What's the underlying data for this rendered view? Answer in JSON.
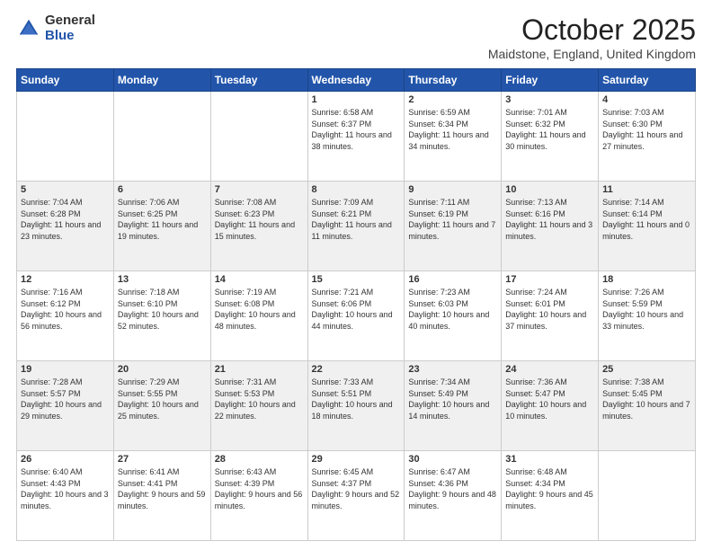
{
  "header": {
    "logo_general": "General",
    "logo_blue": "Blue",
    "title": "October 2025",
    "subtitle": "Maidstone, England, United Kingdom"
  },
  "weekdays": [
    "Sunday",
    "Monday",
    "Tuesday",
    "Wednesday",
    "Thursday",
    "Friday",
    "Saturday"
  ],
  "weeks": [
    [
      {
        "day": "",
        "info": ""
      },
      {
        "day": "",
        "info": ""
      },
      {
        "day": "",
        "info": ""
      },
      {
        "day": "1",
        "info": "Sunrise: 6:58 AM\nSunset: 6:37 PM\nDaylight: 11 hours\nand 38 minutes."
      },
      {
        "day": "2",
        "info": "Sunrise: 6:59 AM\nSunset: 6:34 PM\nDaylight: 11 hours\nand 34 minutes."
      },
      {
        "day": "3",
        "info": "Sunrise: 7:01 AM\nSunset: 6:32 PM\nDaylight: 11 hours\nand 30 minutes."
      },
      {
        "day": "4",
        "info": "Sunrise: 7:03 AM\nSunset: 6:30 PM\nDaylight: 11 hours\nand 27 minutes."
      }
    ],
    [
      {
        "day": "5",
        "info": "Sunrise: 7:04 AM\nSunset: 6:28 PM\nDaylight: 11 hours\nand 23 minutes."
      },
      {
        "day": "6",
        "info": "Sunrise: 7:06 AM\nSunset: 6:25 PM\nDaylight: 11 hours\nand 19 minutes."
      },
      {
        "day": "7",
        "info": "Sunrise: 7:08 AM\nSunset: 6:23 PM\nDaylight: 11 hours\nand 15 minutes."
      },
      {
        "day": "8",
        "info": "Sunrise: 7:09 AM\nSunset: 6:21 PM\nDaylight: 11 hours\nand 11 minutes."
      },
      {
        "day": "9",
        "info": "Sunrise: 7:11 AM\nSunset: 6:19 PM\nDaylight: 11 hours\nand 7 minutes."
      },
      {
        "day": "10",
        "info": "Sunrise: 7:13 AM\nSunset: 6:16 PM\nDaylight: 11 hours\nand 3 minutes."
      },
      {
        "day": "11",
        "info": "Sunrise: 7:14 AM\nSunset: 6:14 PM\nDaylight: 11 hours\nand 0 minutes."
      }
    ],
    [
      {
        "day": "12",
        "info": "Sunrise: 7:16 AM\nSunset: 6:12 PM\nDaylight: 10 hours\nand 56 minutes."
      },
      {
        "day": "13",
        "info": "Sunrise: 7:18 AM\nSunset: 6:10 PM\nDaylight: 10 hours\nand 52 minutes."
      },
      {
        "day": "14",
        "info": "Sunrise: 7:19 AM\nSunset: 6:08 PM\nDaylight: 10 hours\nand 48 minutes."
      },
      {
        "day": "15",
        "info": "Sunrise: 7:21 AM\nSunset: 6:06 PM\nDaylight: 10 hours\nand 44 minutes."
      },
      {
        "day": "16",
        "info": "Sunrise: 7:23 AM\nSunset: 6:03 PM\nDaylight: 10 hours\nand 40 minutes."
      },
      {
        "day": "17",
        "info": "Sunrise: 7:24 AM\nSunset: 6:01 PM\nDaylight: 10 hours\nand 37 minutes."
      },
      {
        "day": "18",
        "info": "Sunrise: 7:26 AM\nSunset: 5:59 PM\nDaylight: 10 hours\nand 33 minutes."
      }
    ],
    [
      {
        "day": "19",
        "info": "Sunrise: 7:28 AM\nSunset: 5:57 PM\nDaylight: 10 hours\nand 29 minutes."
      },
      {
        "day": "20",
        "info": "Sunrise: 7:29 AM\nSunset: 5:55 PM\nDaylight: 10 hours\nand 25 minutes."
      },
      {
        "day": "21",
        "info": "Sunrise: 7:31 AM\nSunset: 5:53 PM\nDaylight: 10 hours\nand 22 minutes."
      },
      {
        "day": "22",
        "info": "Sunrise: 7:33 AM\nSunset: 5:51 PM\nDaylight: 10 hours\nand 18 minutes."
      },
      {
        "day": "23",
        "info": "Sunrise: 7:34 AM\nSunset: 5:49 PM\nDaylight: 10 hours\nand 14 minutes."
      },
      {
        "day": "24",
        "info": "Sunrise: 7:36 AM\nSunset: 5:47 PM\nDaylight: 10 hours\nand 10 minutes."
      },
      {
        "day": "25",
        "info": "Sunrise: 7:38 AM\nSunset: 5:45 PM\nDaylight: 10 hours\nand 7 minutes."
      }
    ],
    [
      {
        "day": "26",
        "info": "Sunrise: 6:40 AM\nSunset: 4:43 PM\nDaylight: 10 hours\nand 3 minutes."
      },
      {
        "day": "27",
        "info": "Sunrise: 6:41 AM\nSunset: 4:41 PM\nDaylight: 9 hours\nand 59 minutes."
      },
      {
        "day": "28",
        "info": "Sunrise: 6:43 AM\nSunset: 4:39 PM\nDaylight: 9 hours\nand 56 minutes."
      },
      {
        "day": "29",
        "info": "Sunrise: 6:45 AM\nSunset: 4:37 PM\nDaylight: 9 hours\nand 52 minutes."
      },
      {
        "day": "30",
        "info": "Sunrise: 6:47 AM\nSunset: 4:36 PM\nDaylight: 9 hours\nand 48 minutes."
      },
      {
        "day": "31",
        "info": "Sunrise: 6:48 AM\nSunset: 4:34 PM\nDaylight: 9 hours\nand 45 minutes."
      },
      {
        "day": "",
        "info": ""
      }
    ]
  ]
}
